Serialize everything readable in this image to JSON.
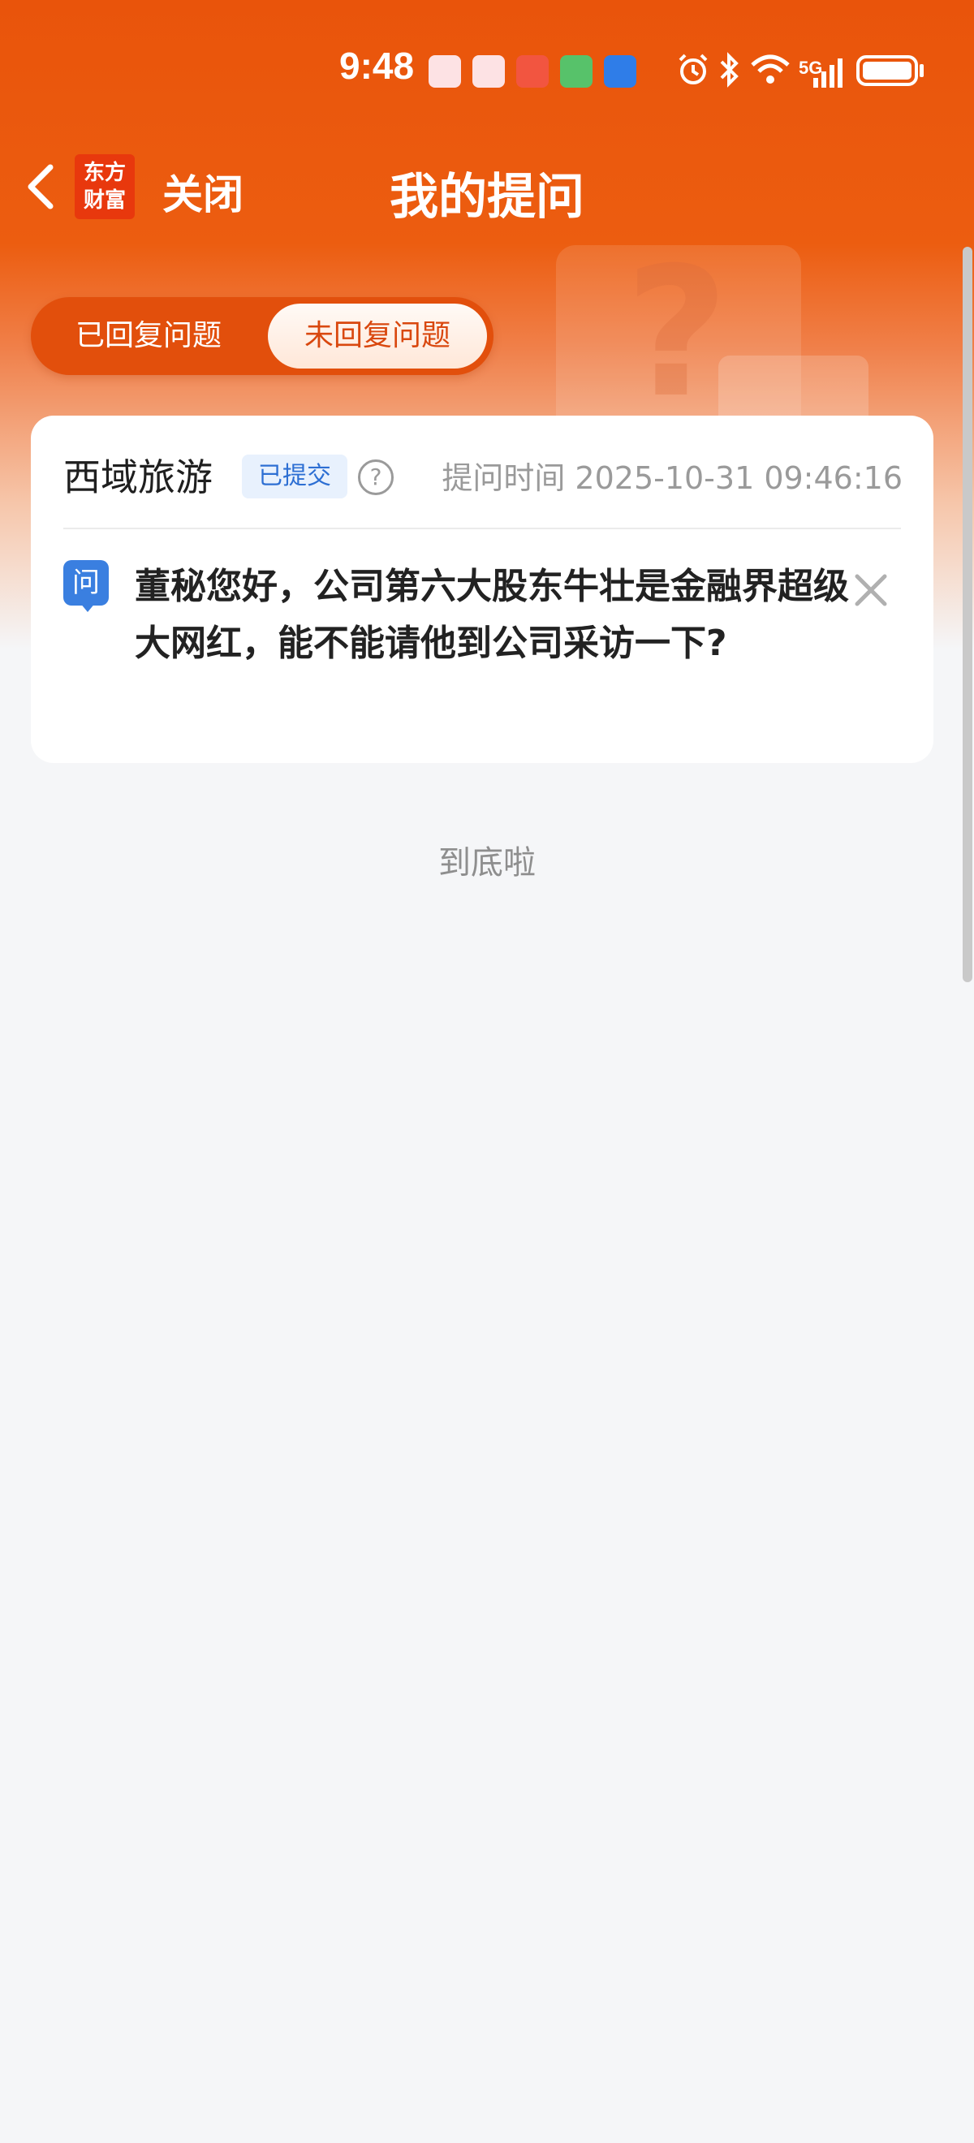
{
  "status_bar": {
    "time": "9:48",
    "network": "5G",
    "icons": [
      "book-app-icon",
      "book-app-icon",
      "news-app-icon",
      "green-app-icon",
      "browser-app-icon",
      "alarm-icon",
      "bluetooth-icon",
      "wifi-icon",
      "signal-icon",
      "battery-icon"
    ]
  },
  "nav": {
    "logo_line1": "东方",
    "logo_line2": "财富",
    "close_label": "关闭",
    "title": "我的提问"
  },
  "tabs": {
    "answered": "已回复问题",
    "unanswered": "未回复问题",
    "active": "unanswered"
  },
  "question_card": {
    "company": "西域旅游",
    "status_badge": "已提交",
    "help_glyph": "?",
    "time_stamp": "提问时间 2025-10-31 09:46:16",
    "q_icon_label": "问",
    "question_text": "董秘您好，公司第六大股东牛壮是金融界超级大网红，能不能请他到公司采访一下?"
  },
  "end_text": "到底啦",
  "colors": {
    "brand_orange": "#e9540b",
    "active_tab_text": "#d9480f",
    "badge_blue": "#2d6fd3",
    "q_icon_blue": "#3a7fe0"
  }
}
